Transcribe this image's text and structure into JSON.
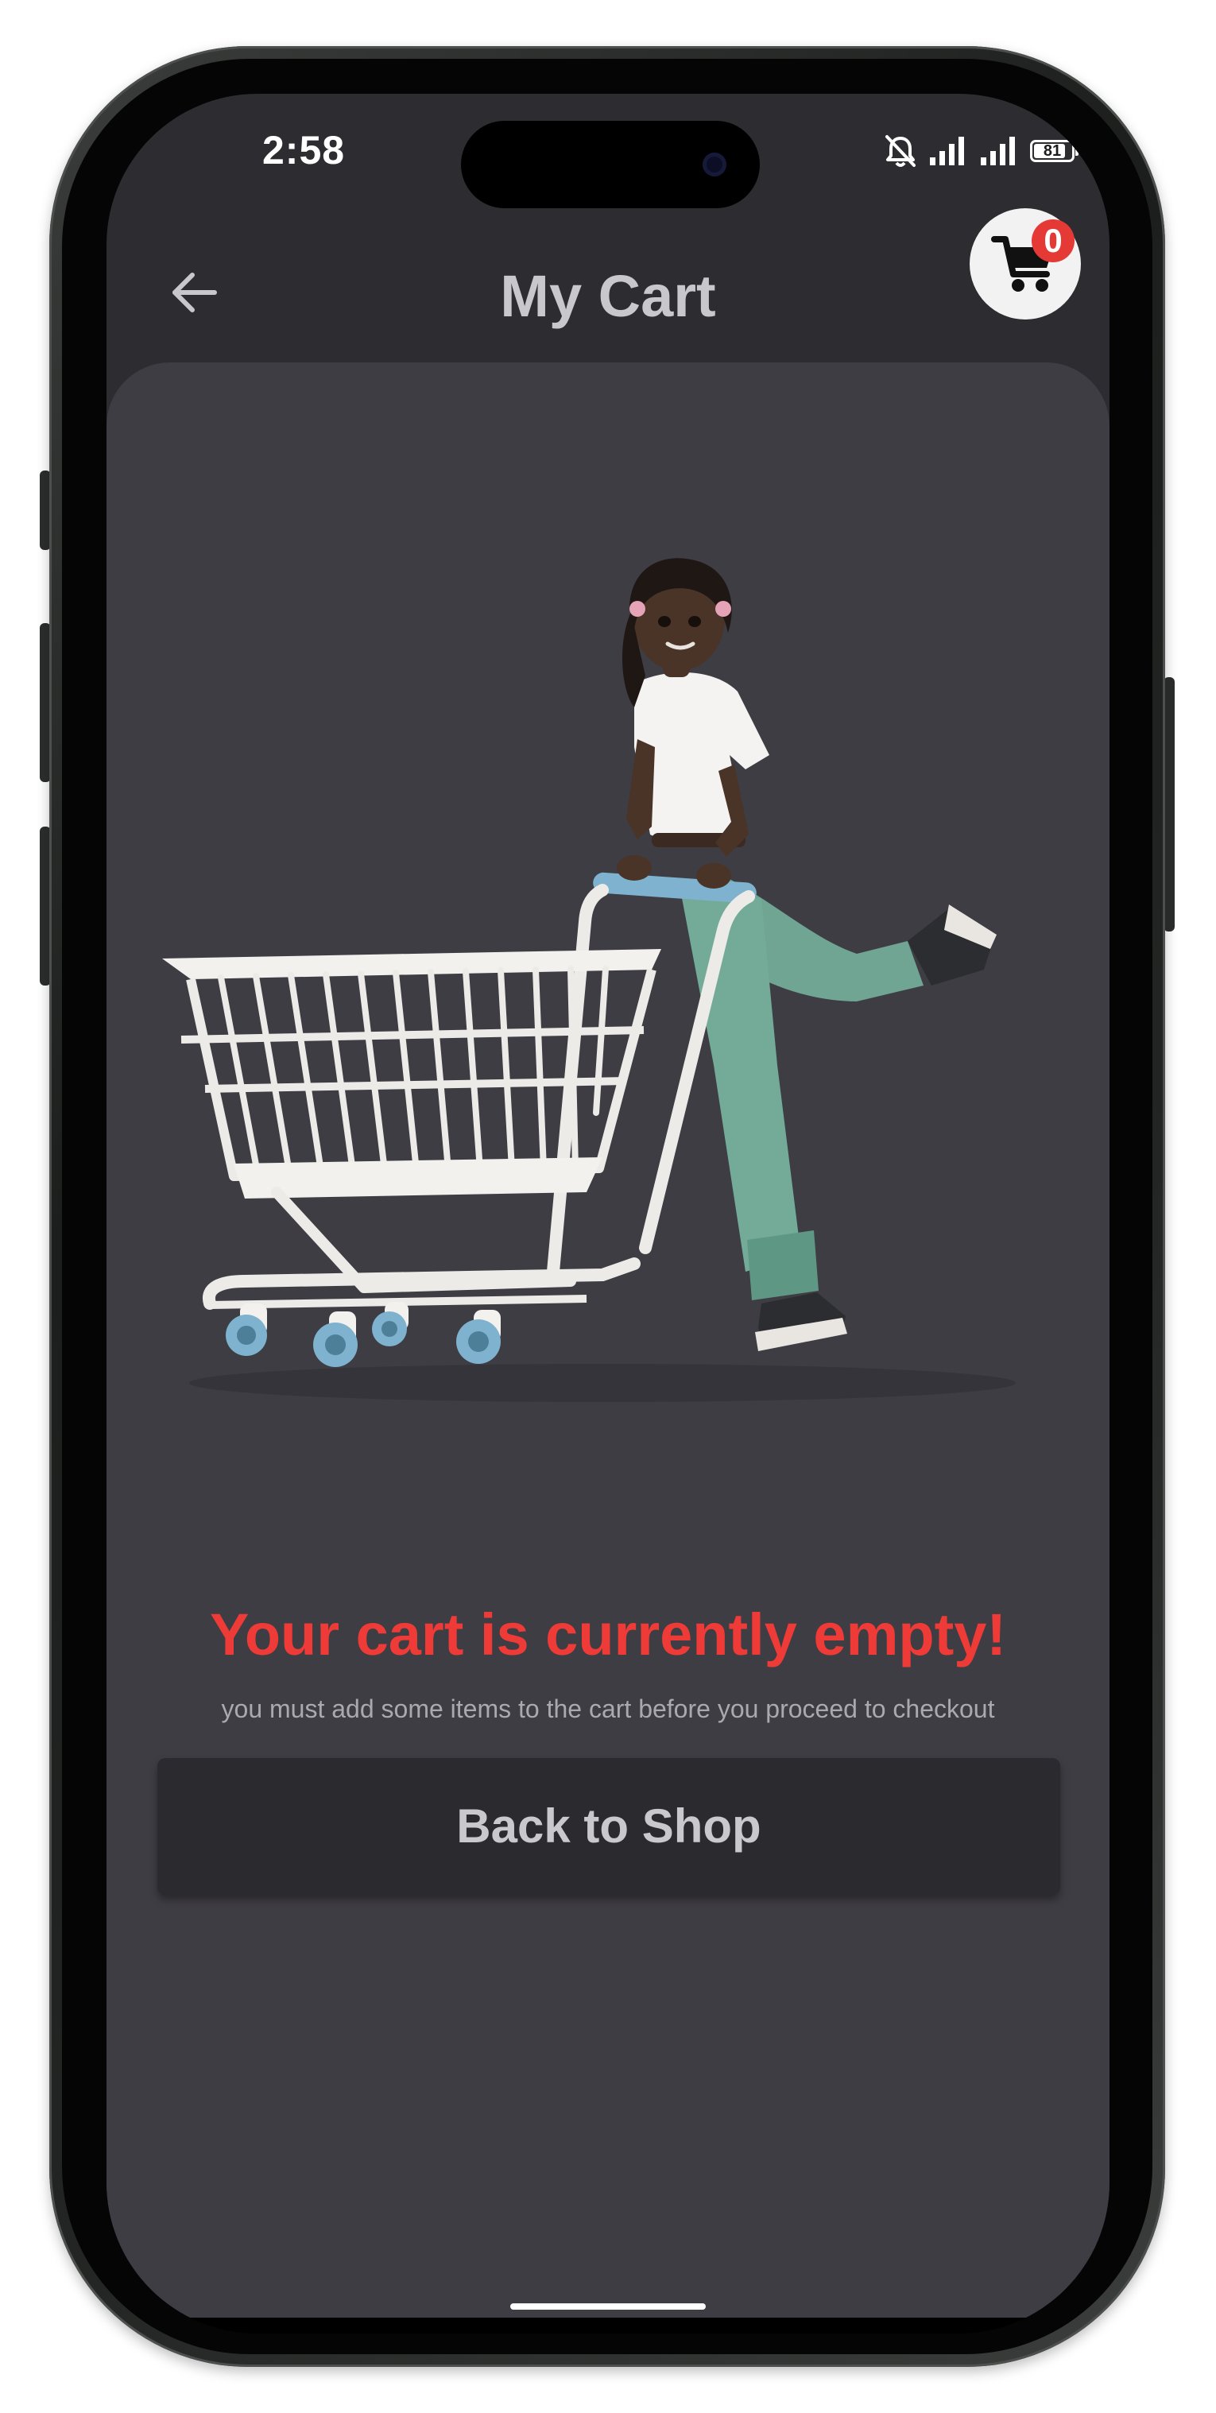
{
  "status_bar": {
    "time": "2:58",
    "battery_level": "81",
    "icons": [
      "bell-off-icon",
      "signal-icon",
      "signal-icon",
      "battery-icon"
    ]
  },
  "header": {
    "title": "My Cart",
    "back_icon": "arrow-left-icon",
    "cart_icon": "shopping-cart-icon",
    "cart_count": "0"
  },
  "empty_state": {
    "illustration": "woman-pushing-shopping-cart",
    "title": "Your cart is currently empty!",
    "message": "you must add some items to the cart before you proceed to checkout",
    "button_label": "Back to Shop"
  },
  "colors": {
    "background": "#2d2d31",
    "card": "#3e3d43",
    "accent_red": "#ee3b37",
    "button": "#2b2b2f",
    "title_text": "#c8c8cc"
  }
}
